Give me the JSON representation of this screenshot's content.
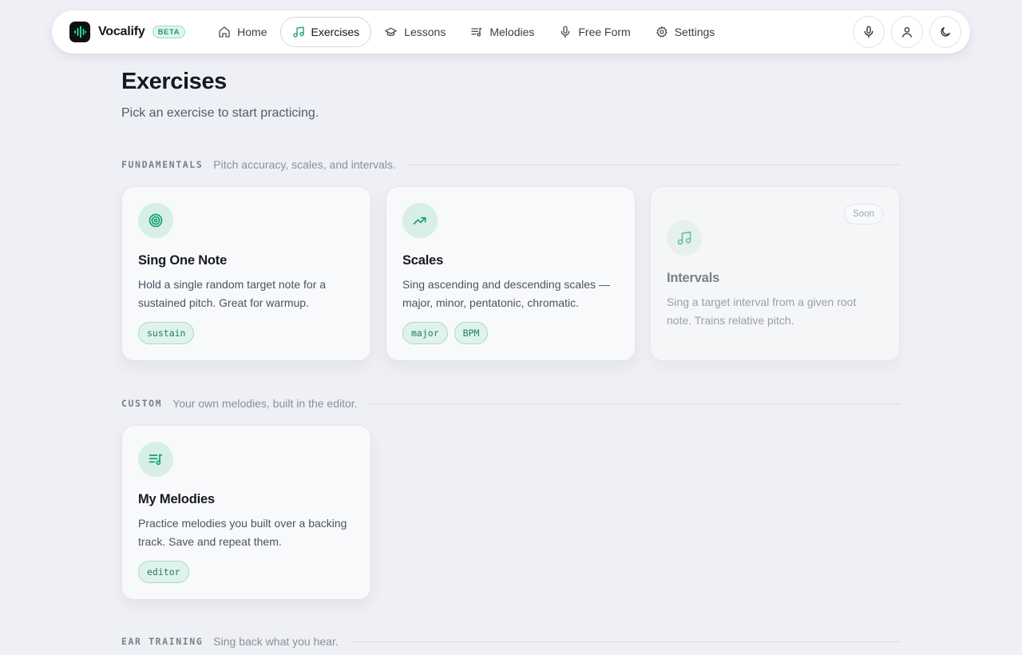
{
  "brand": {
    "name": "Vocalify",
    "badge": "BETA"
  },
  "nav": {
    "items": [
      {
        "label": "Home",
        "icon": "home-icon",
        "active": false
      },
      {
        "label": "Exercises",
        "icon": "music-note-icon",
        "active": true
      },
      {
        "label": "Lessons",
        "icon": "graduation-cap-icon",
        "active": false
      },
      {
        "label": "Melodies",
        "icon": "playlist-music-icon",
        "active": false
      },
      {
        "label": "Free Form",
        "icon": "microphone-icon",
        "active": false
      },
      {
        "label": "Settings",
        "icon": "gear-icon",
        "active": false
      }
    ],
    "actions": [
      "microphone-icon",
      "user-icon",
      "moon-icon"
    ]
  },
  "page": {
    "title": "Exercises",
    "subtitle": "Pick an exercise to start practicing."
  },
  "sections": [
    {
      "label": "FUNDAMENTALS",
      "description": "Pitch accuracy, scales, and intervals.",
      "cards": [
        {
          "title": "Sing One Note",
          "description": "Hold a single random target note for a sustained pitch. Great for warmup.",
          "tags": [
            "sustain"
          ],
          "icon": "target-icon"
        },
        {
          "title": "Scales",
          "description": "Sing ascending and descending scales — major, minor, pentatonic, chromatic.",
          "tags": [
            "major",
            "BPM"
          ],
          "icon": "trending-up-icon"
        },
        {
          "title": "Intervals",
          "description": "Sing a target interval from a given root note. Trains relative pitch.",
          "badge": "Soon",
          "icon": "music-notes-icon"
        }
      ]
    },
    {
      "label": "CUSTOM",
      "description": "Your own melodies, built in the editor.",
      "cards": [
        {
          "title": "My Melodies",
          "description": "Practice melodies you built over a backing track. Save and repeat them.",
          "tags": [
            "editor"
          ],
          "icon": "playlist-music-icon"
        }
      ]
    },
    {
      "label": "EAR TRAINING",
      "description": "Sing back what you hear."
    }
  ],
  "colors": {
    "accent": "#159e72",
    "background": "#eff0f5",
    "card": "#f8f9fb"
  }
}
